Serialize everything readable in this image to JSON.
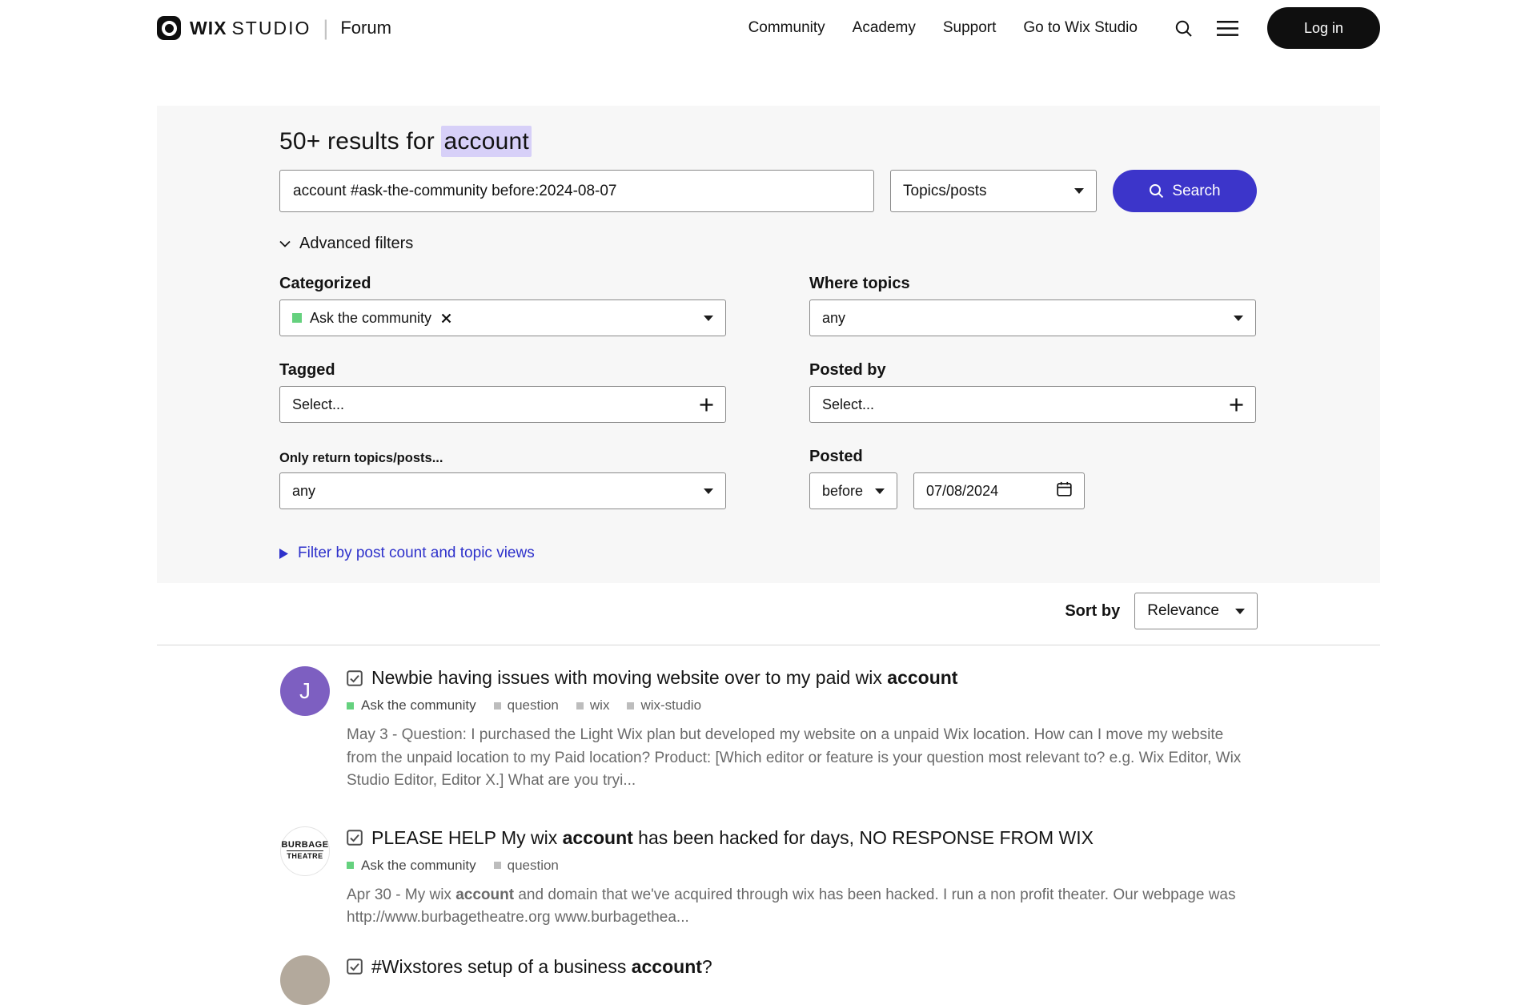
{
  "header": {
    "brand_wix": "WIX",
    "brand_studio": "STUDIO",
    "brand_sep": "|",
    "brand_forum": "Forum",
    "nav": [
      "Community",
      "Academy",
      "Support",
      "Go to Wix Studio"
    ],
    "login": "Log in"
  },
  "searchbar": {
    "title_prefix": "50+ results for ",
    "title_highlight": "account",
    "query": "account #ask-the-community before:2024-08-07",
    "type_value": "Topics/posts",
    "search_label": "Search",
    "advanced_label": "Advanced filters"
  },
  "filters": {
    "categorized_label": "Categorized",
    "categorized_chip": "Ask the community",
    "tagged_label": "Tagged",
    "tagged_placeholder": "Select...",
    "only_label": "Only return topics/posts...",
    "only_value": "any",
    "where_label": "Where topics",
    "where_value": "any",
    "postedby_label": "Posted by",
    "postedby_placeholder": "Select...",
    "posted_label": "Posted",
    "posted_when": "before",
    "posted_date": "07/08/2024",
    "count_link": "Filter by post count and topic views"
  },
  "sort": {
    "label": "Sort by",
    "value": "Relevance"
  },
  "results": [
    {
      "avatar_text": "J",
      "title_pre": "Newbie having issues with moving website over to my paid wix ",
      "title_bold": "account",
      "title_post": "",
      "category": "Ask the community",
      "tags": [
        "question",
        "wix",
        "wix-studio"
      ],
      "excerpt_date": "May 3 - ",
      "excerpt_pre": "Question: I purchased the Light Wix plan but developed my website on a unpaid Wix location. How can I move my website from the unpaid location to my Paid location? Product: [Which editor or feature is your question most relevant to? e.g. Wix Editor, Wix Studio Editor, Editor X.] What are you tryi...",
      "excerpt_bold": "",
      "excerpt_post": ""
    },
    {
      "avatar_line1": "BURBAGE",
      "avatar_line2": "THEATRE",
      "title_pre": "PLEASE HELP My wix ",
      "title_bold": "account",
      "title_post": " has been hacked for days, NO RESPONSE FROM WIX",
      "category": "Ask the community",
      "tags": [
        "question"
      ],
      "excerpt_date": "Apr 30 - ",
      "excerpt_pre": "My wix ",
      "excerpt_bold": "account",
      "excerpt_post": " and domain that we've acquired through wix has been hacked. I run a non profit theater. Our webpage was http://www.burbagetheatre.org www.burbagethea..."
    },
    {
      "title_pre": "#Wixstores setup of a business ",
      "title_bold": "account",
      "title_post": "?"
    }
  ],
  "colors": {
    "accent_button": "#3c35ca",
    "link_blue": "#2e31cb",
    "title_highlight": "#d7d0f8",
    "category_green": "#65d17e",
    "tag_gray": "#bdbdbd",
    "avatar_purple": "#7d5fc1"
  }
}
